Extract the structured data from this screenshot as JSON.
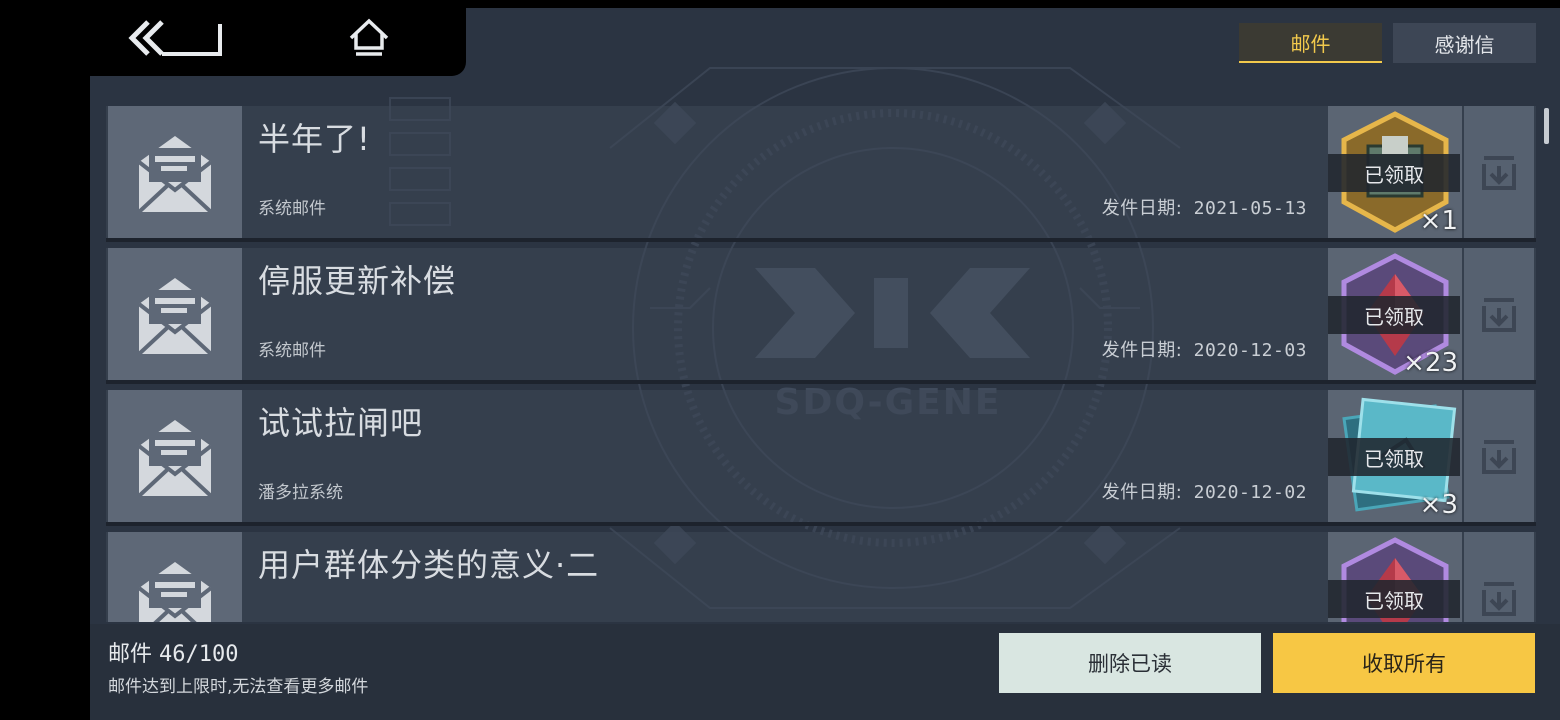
{
  "nav": {
    "back_icon": "double-chevron-back-icon",
    "home_icon": "home-icon"
  },
  "tabs": [
    {
      "label": "邮件",
      "active": true
    },
    {
      "label": "感谢信",
      "active": false
    }
  ],
  "background_logo": "SDQ-GENE",
  "mails": [
    {
      "subject": "半年了!",
      "sender": "系统邮件",
      "date_label": "发件日期:",
      "date": "2021-05-13",
      "reward_icon": "gold-chip-icon",
      "claimed": "已领取",
      "qty": "×1"
    },
    {
      "subject": "停服更新补偿",
      "sender": "系统邮件",
      "date_label": "发件日期:",
      "date": "2020-12-03",
      "reward_icon": "purple-crystal-icon",
      "claimed": "已领取",
      "qty": "×23"
    },
    {
      "subject": "试试拉闸吧",
      "sender": "潘多拉系统",
      "date_label": "发件日期:",
      "date": "2020-12-02",
      "reward_icon": "blueprint-icon",
      "claimed": "已领取",
      "qty": "×3"
    },
    {
      "subject": "用户群体分类的意义·二",
      "sender": "",
      "date_label": "",
      "date": "",
      "reward_icon": "purple-crystal-icon",
      "claimed": "已领取",
      "qty": ""
    }
  ],
  "footer": {
    "count_label": "邮件",
    "count_value": "46/100",
    "limit_note": "邮件达到上限时,无法查看更多邮件",
    "delete_read": "删除已读",
    "claim_all": "收取所有"
  },
  "colors": {
    "accent_yellow": "#f7c744",
    "tab_active_text": "#f2c94c",
    "panel": "#2b3442",
    "delete_button": "#d9e6e1"
  }
}
